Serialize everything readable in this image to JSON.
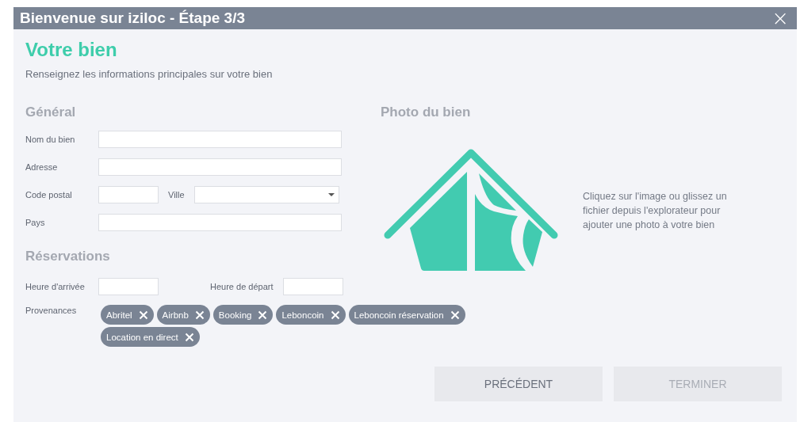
{
  "window": {
    "title": "Bienvenue sur iziloc - Étape 3/3",
    "close": "×"
  },
  "heading": "Votre bien",
  "subtitle": "Renseignez les informations principales sur votre bien",
  "general": {
    "title": "Général",
    "rows": [
      [
        {
          "label": "Nom du bien",
          "kind": "text"
        }
      ],
      [
        {
          "label": "Adresse",
          "kind": "text"
        }
      ],
      [
        {
          "label": "Code postal",
          "kind": "short"
        },
        {
          "label": "Ville",
          "kind": "select"
        }
      ],
      [
        {
          "label": "Pays",
          "kind": "text"
        }
      ]
    ]
  },
  "photo": {
    "title": "Photo du bien",
    "hint": "Cliquez sur l'image ou glissez un fichier depuis l'explorateur pour ajouter une photo à votre bien"
  },
  "reservations": {
    "title": "Réservations",
    "times": [
      {
        "label": "Heure d'arrivée"
      },
      {
        "label": "Heure de départ"
      }
    ],
    "sources_label": "Provenances",
    "sources": [
      {
        "label": "Abritel"
      },
      {
        "label": "Airbnb"
      },
      {
        "label": "Booking"
      },
      {
        "label": "Leboncoin"
      },
      {
        "label": "Leboncoin réservation"
      },
      {
        "label": "Location en direct"
      }
    ]
  },
  "buttons": [
    {
      "label": "PRÉCÉDENT",
      "disabled": false
    },
    {
      "label": "TERMINER",
      "disabled": true
    }
  ]
}
